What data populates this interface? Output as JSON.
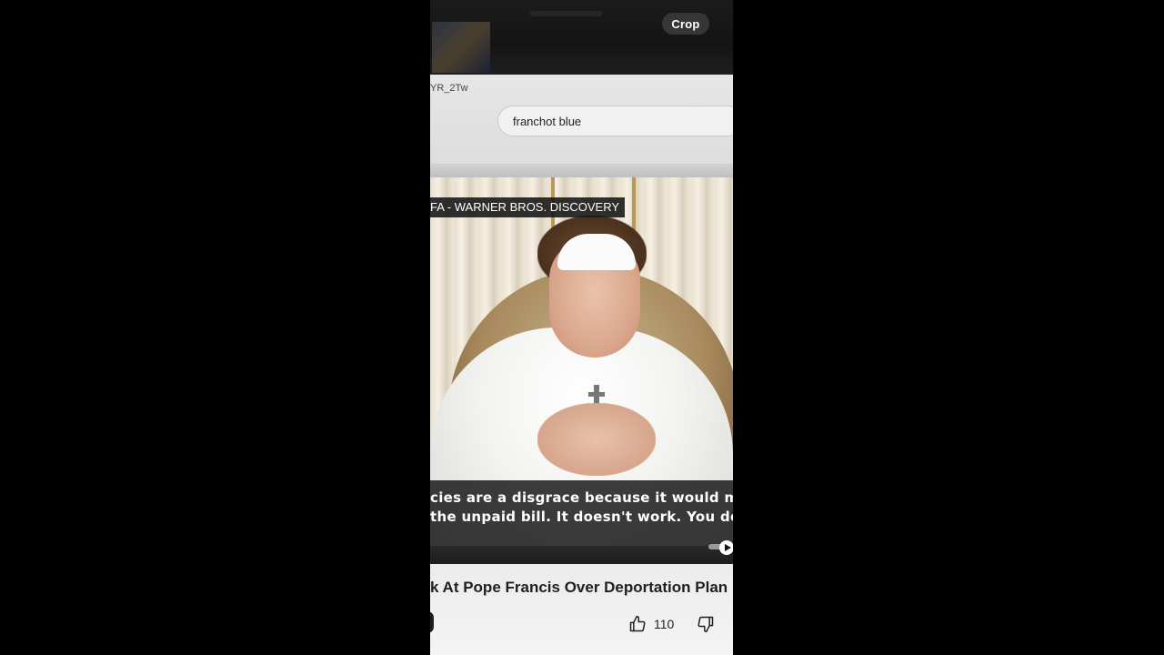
{
  "overlay": {
    "crop_label": "Crop"
  },
  "browser": {
    "url_fragment": "YR_2Tw",
    "search_value": "franchot blue"
  },
  "video": {
    "chyron": "FA - WARNER BROS. DISCOVERY",
    "caption_line1": "cies are a disgrace because it would make the po",
    "caption_line2": "the unpaid bill. It doesn't work. You don't resolve"
  },
  "below": {
    "title": "k At Pope Francis Over Deportation Plan |",
    "like_count": "110"
  },
  "icons": {
    "like": "thumbs-up-icon",
    "dislike": "thumbs-down-icon",
    "play": "play-icon"
  },
  "colors": {
    "page_bg": "#000000",
    "caption_bg": "#121212",
    "text_dark": "#1f1f1f"
  }
}
